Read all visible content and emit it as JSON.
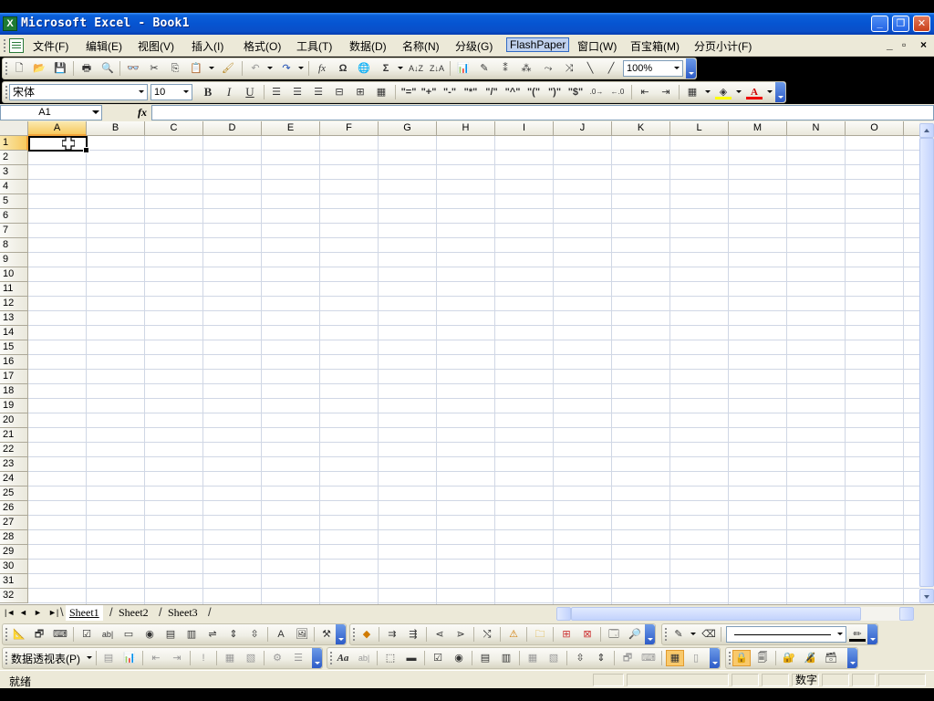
{
  "window": {
    "title": "Microsoft Excel - Book1",
    "app_icon": "X",
    "controls": [
      "minimize",
      "maximize",
      "close"
    ]
  },
  "menu": {
    "items": [
      "文件(F)",
      "编辑(E)",
      "视图(V)",
      "插入(I)",
      "格式(O)",
      "工具(T)",
      "数据(D)",
      "名称(N)",
      "分级(G)",
      "FlashPaper",
      "窗口(W)",
      "百宝箱(M)",
      "分页小计(F)"
    ],
    "active_index": 9,
    "mdi_controls": [
      "_",
      "▫",
      "×"
    ]
  },
  "standard_toolbar": {
    "zoom": "100%"
  },
  "format_toolbar": {
    "font_name": "宋体",
    "font_size": "10",
    "bold": "B",
    "italic": "I",
    "underline": "U",
    "symbols": [
      "\"=\"",
      "\"+\"",
      "\"-\"",
      "\"*\"",
      "\"/\"",
      "\"^\"",
      "\"(\"",
      "\")\"",
      "\"$\""
    ]
  },
  "formula_bar": {
    "name_box": "A1",
    "fx": "fx",
    "formula": ""
  },
  "grid": {
    "columns": [
      "A",
      "B",
      "C",
      "D",
      "E",
      "F",
      "G",
      "H",
      "I",
      "J",
      "K",
      "L",
      "M",
      "N",
      "O"
    ],
    "rows": [
      "1",
      "2",
      "3",
      "4",
      "5",
      "6",
      "7",
      "8",
      "9",
      "10",
      "11",
      "12",
      "13",
      "14",
      "15",
      "16",
      "17",
      "18",
      "19",
      "20",
      "21",
      "22",
      "23",
      "24",
      "25",
      "26",
      "27",
      "28",
      "29",
      "30",
      "31",
      "32"
    ],
    "selected_column": "A",
    "selected_row": "1"
  },
  "sheets": {
    "tabs": [
      "Sheet1",
      "Sheet2",
      "Sheet3"
    ],
    "active_index": 0,
    "nav": [
      "|◄",
      "◄",
      "►",
      "►|"
    ]
  },
  "pivot_toolbar": {
    "label": "数据透视表(P)"
  },
  "status": {
    "message": "就绪",
    "num_mode": "数字"
  },
  "colors": {
    "title_bar": "#0654d1",
    "chrome": "#ece9d8",
    "selection_header": "#f7c95e",
    "grid_line": "#d0d7e5"
  }
}
